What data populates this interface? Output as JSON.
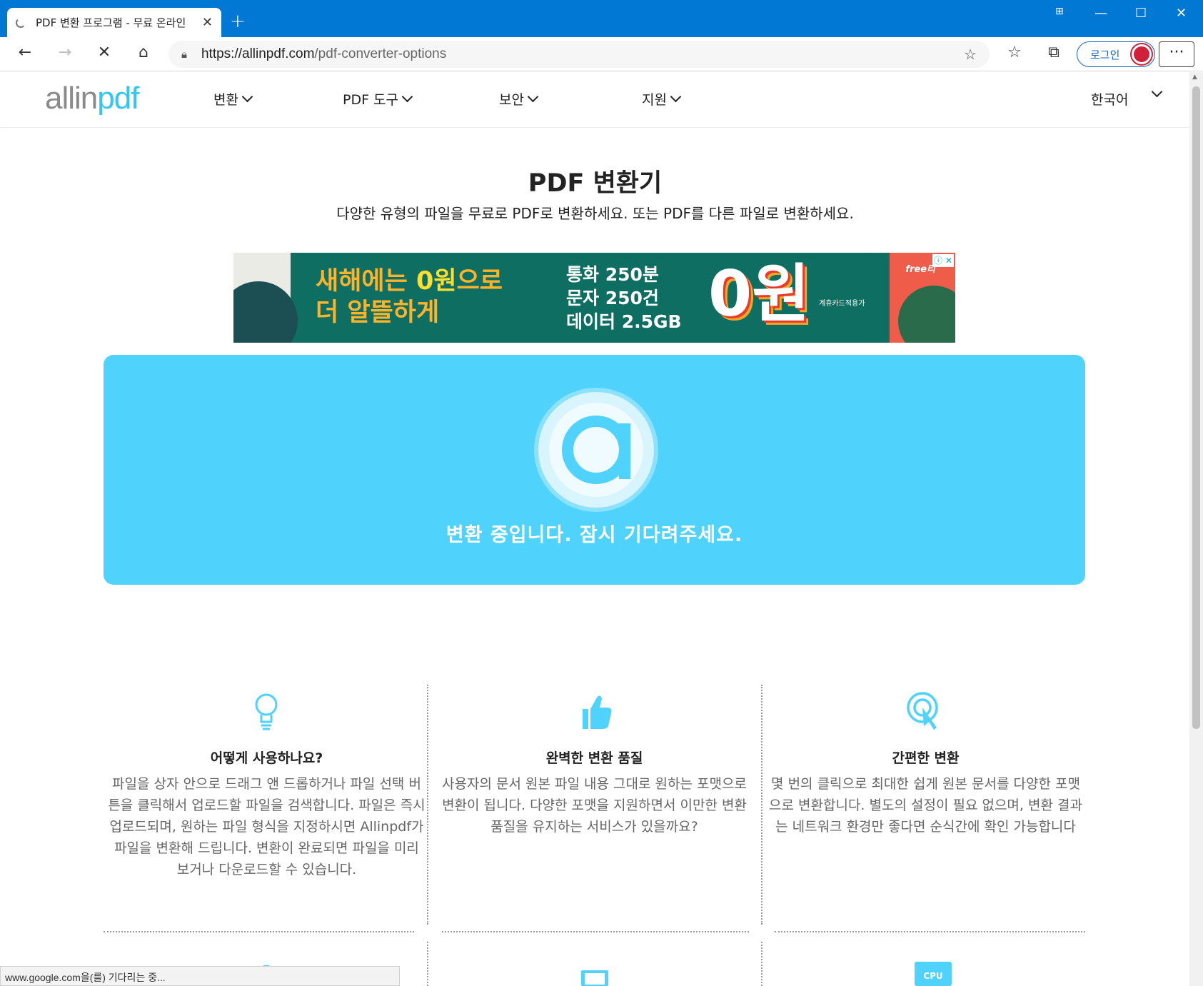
{
  "browser": {
    "tab_title": "PDF 변환 프로그램 - 무료 온라인",
    "new_tab": "+",
    "url_host": "https://allinpdf.com",
    "url_path": "/pdf-converter-options",
    "login_label": "로그인",
    "more_label": "···",
    "status_text": "www.google.com을(를) 기다리는 중..."
  },
  "header": {
    "logo_main": "allin",
    "logo_accent": "pdf",
    "nav": [
      {
        "label": "변환"
      },
      {
        "label": "PDF 도구"
      },
      {
        "label": "보안"
      },
      {
        "label": "지원"
      }
    ],
    "language": "한국어"
  },
  "hero": {
    "title": "PDF 변환기",
    "subtitle": "다양한 유형의 파일을 무료로 PDF로 변환하세요. 또는 PDF를 다른 파일로 변환하세요."
  },
  "ad": {
    "headline_1": "새해에는 ",
    "headline_hl": "0원",
    "headline_2": "으로",
    "headline_3": "더 알뜰하게",
    "plan_1": "통화 250분",
    "plan_2": "문자 250건",
    "plan_3": "데이터 2.5GB",
    "big_price": "0원",
    "note": "계휴카드적용가",
    "brand": "free티",
    "close": "ⓘ ✕"
  },
  "converter": {
    "status": "변환 중입니다. 잠시 기다려주세요."
  },
  "features": [
    {
      "icon": "lightbulb-icon",
      "title": "어떻게 사용하나요?",
      "text": "파일을 상자 안으로 드래그 앤 드롭하거나 파일 선택 버튼을 클릭해서 업로드할 파일을 검색합니다. 파일은 즉시 업로드되며, 원하는 파일 형식을 지정하시면 Allinpdf가 파일을 변환해 드립니다. 변환이 완료되면 파일을 미리 보거나 다운로드할 수 있습니다."
    },
    {
      "icon": "thumbs-up-icon",
      "title": "완벽한 변환 품질",
      "text": "사용자의 문서 원본 파일 내용 그대로 원하는 포맷으로 변환이 됩니다. 다양한 포맷을 지원하면서 이만한 변환 품질을 유지하는 서비스가 있을까요?"
    },
    {
      "icon": "click-pointer-icon",
      "title": "간편한 변환",
      "text": "몇 번의 클릭으로 최대한 쉽게 원본 문서를 다양한 포맷으로 변환합니다. 별도의 설정이 필요 없으며, 변환 결과는 네트워크 환경만 좋다면 순식간에 확인 가능합니다"
    }
  ],
  "bottom_icons": {
    "cpu_label": "CPU"
  },
  "colors": {
    "browser_blue": "#0078d4",
    "accent_cyan": "#4fd2fc",
    "logo_cyan": "#33c6f4"
  }
}
